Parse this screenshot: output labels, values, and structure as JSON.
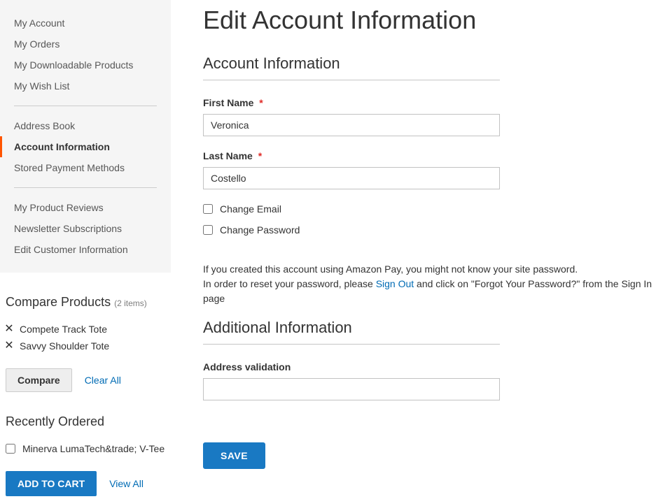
{
  "page": {
    "title": "Edit Account Information"
  },
  "sidebar": {
    "nav": [
      {
        "label": "My Account",
        "active": false
      },
      {
        "label": "My Orders",
        "active": false
      },
      {
        "label": "My Downloadable Products",
        "active": false
      },
      {
        "label": "My Wish List",
        "active": false
      },
      {
        "divider": true
      },
      {
        "label": "Address Book",
        "active": false
      },
      {
        "label": "Account Information",
        "active": true
      },
      {
        "label": "Stored Payment Methods",
        "active": false
      },
      {
        "divider": true
      },
      {
        "label": "My Product Reviews",
        "active": false
      },
      {
        "label": "Newsletter Subscriptions",
        "active": false
      },
      {
        "label": "Edit Customer Information",
        "active": false
      }
    ]
  },
  "compare": {
    "title": "Compare Products",
    "count_label": "(2 items)",
    "items": [
      {
        "name": "Compete Track Tote"
      },
      {
        "name": "Savvy Shoulder Tote"
      }
    ],
    "compare_label": "Compare",
    "clear_label": "Clear All"
  },
  "recent": {
    "title": "Recently Ordered",
    "items": [
      {
        "name": "Minerva LumaTech&trade; V-Tee"
      }
    ],
    "add_label": "ADD TO CART",
    "view_label": "View All"
  },
  "form": {
    "section1_title": "Account Information",
    "first_name_label": "First Name",
    "first_name_value": "Veronica",
    "last_name_label": "Last Name",
    "last_name_value": "Costello",
    "change_email_label": "Change Email",
    "change_password_label": "Change Password",
    "info_text_1": "If you created this account using Amazon Pay, you might not know your site password.",
    "info_text_2a": "In order to reset your password, please ",
    "info_text_2_link": "Sign Out",
    "info_text_2b": " and click on \"Forgot Your Password?\" from the Sign In page",
    "section2_title": "Additional Information",
    "address_validation_label": "Address validation",
    "address_validation_value": "",
    "save_label": "SAVE"
  }
}
